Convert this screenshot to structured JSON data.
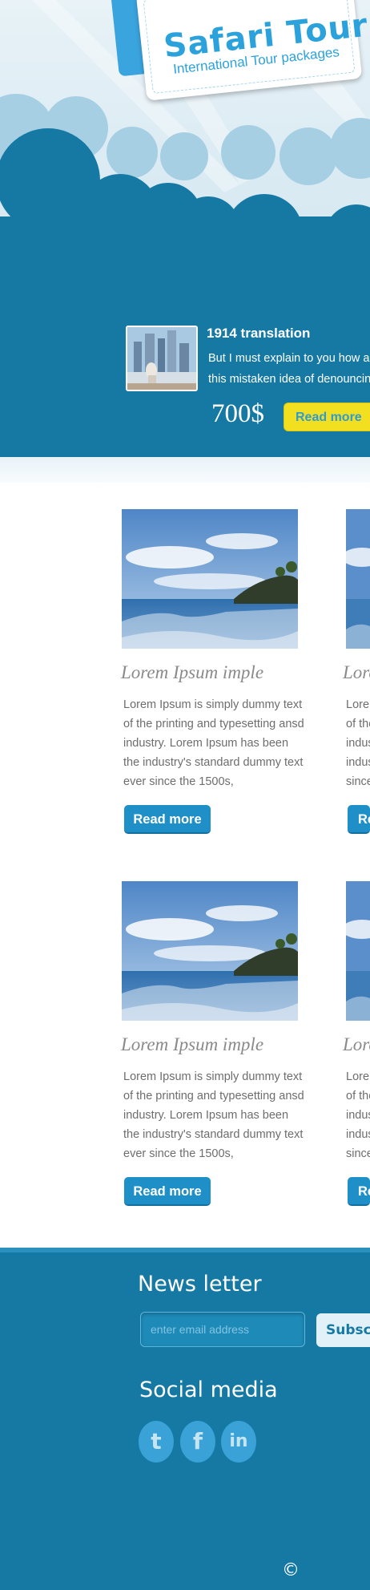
{
  "header": {
    "logo_title": "Safari Tour",
    "logo_subtitle": "International Tour packages"
  },
  "featured": {
    "title": "1914 translation",
    "text_line1": "But I must explain to you how all",
    "text_line2": "this mistaken idea of denouncing",
    "price": "700$",
    "button_label": "Read more"
  },
  "cards": [
    {
      "title": "Lorem Ipsum imple",
      "text": "Lorem Ipsum is simply dummy text of the printing and typesetting ansd industry. Lorem Ipsum has been the industry's standard dummy text ever since the 1500s,",
      "button_label": "Read more"
    },
    {
      "title": "Lorem Ipsum imple",
      "text": "Lorem Ipsum is simply dummy text of the printing and typesetting ansd industry. Lorem Ipsum has been the industry's standard dummy text ever since the 1500s,",
      "button_label": "Read more"
    }
  ],
  "partial_cards": [
    {
      "title": "Lore",
      "lines": [
        "Lore",
        "of the",
        "indus",
        "indus",
        "since"
      ],
      "button_label": "Re"
    },
    {
      "title": "Lore",
      "lines": [
        "Lore",
        "of the",
        "indus",
        "indus",
        "since"
      ],
      "button_label": "Re"
    }
  ],
  "newsletter": {
    "title": "News letter",
    "placeholder": "enter email address",
    "button_label": "Subscribe"
  },
  "social": {
    "title": "Social media",
    "icons": [
      {
        "name": "twitter-icon",
        "glyph": "t"
      },
      {
        "name": "facebook-icon",
        "glyph": "f"
      },
      {
        "name": "linkedin-icon",
        "glyph": "in"
      }
    ]
  },
  "footer": {
    "copyright": "©"
  },
  "colors": {
    "primary_blue": "#1679a4",
    "accent_blue": "#2ba2dc",
    "read_more_yellow": "#f2e020",
    "card_button": "#1f8fc8"
  }
}
